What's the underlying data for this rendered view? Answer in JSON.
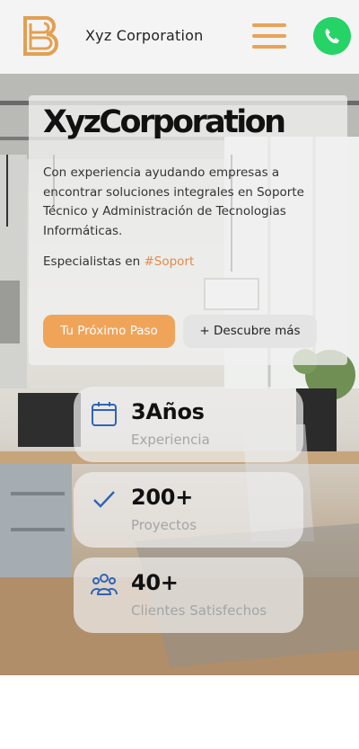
{
  "header": {
    "brand_name": "Xyz Corporation",
    "logo_letter": "B",
    "accent_color": "#e9a356",
    "whatsapp_color": "#25d366"
  },
  "hero": {
    "title": "XyzCorporation",
    "description": "Con experiencia ayudando empresas a encontrar soluciones integrales en Soporte Técnico y Administración de Tecnologias Informáticas.",
    "specialists_prefix": "Especialistas en",
    "specialists_highlight": "#Soport",
    "highlight_color": "#e38a4a",
    "primary_button": "Tu Próximo Paso",
    "secondary_button": "+ Descubre más"
  },
  "stats": [
    {
      "value": "3Años",
      "label": "Experiencia",
      "icon": "calendar-icon"
    },
    {
      "value": "200+",
      "label": "Proyectos",
      "icon": "check-icon"
    },
    {
      "value": "40+",
      "label": "Clientes Satisfechos",
      "icon": "users-icon"
    }
  ]
}
